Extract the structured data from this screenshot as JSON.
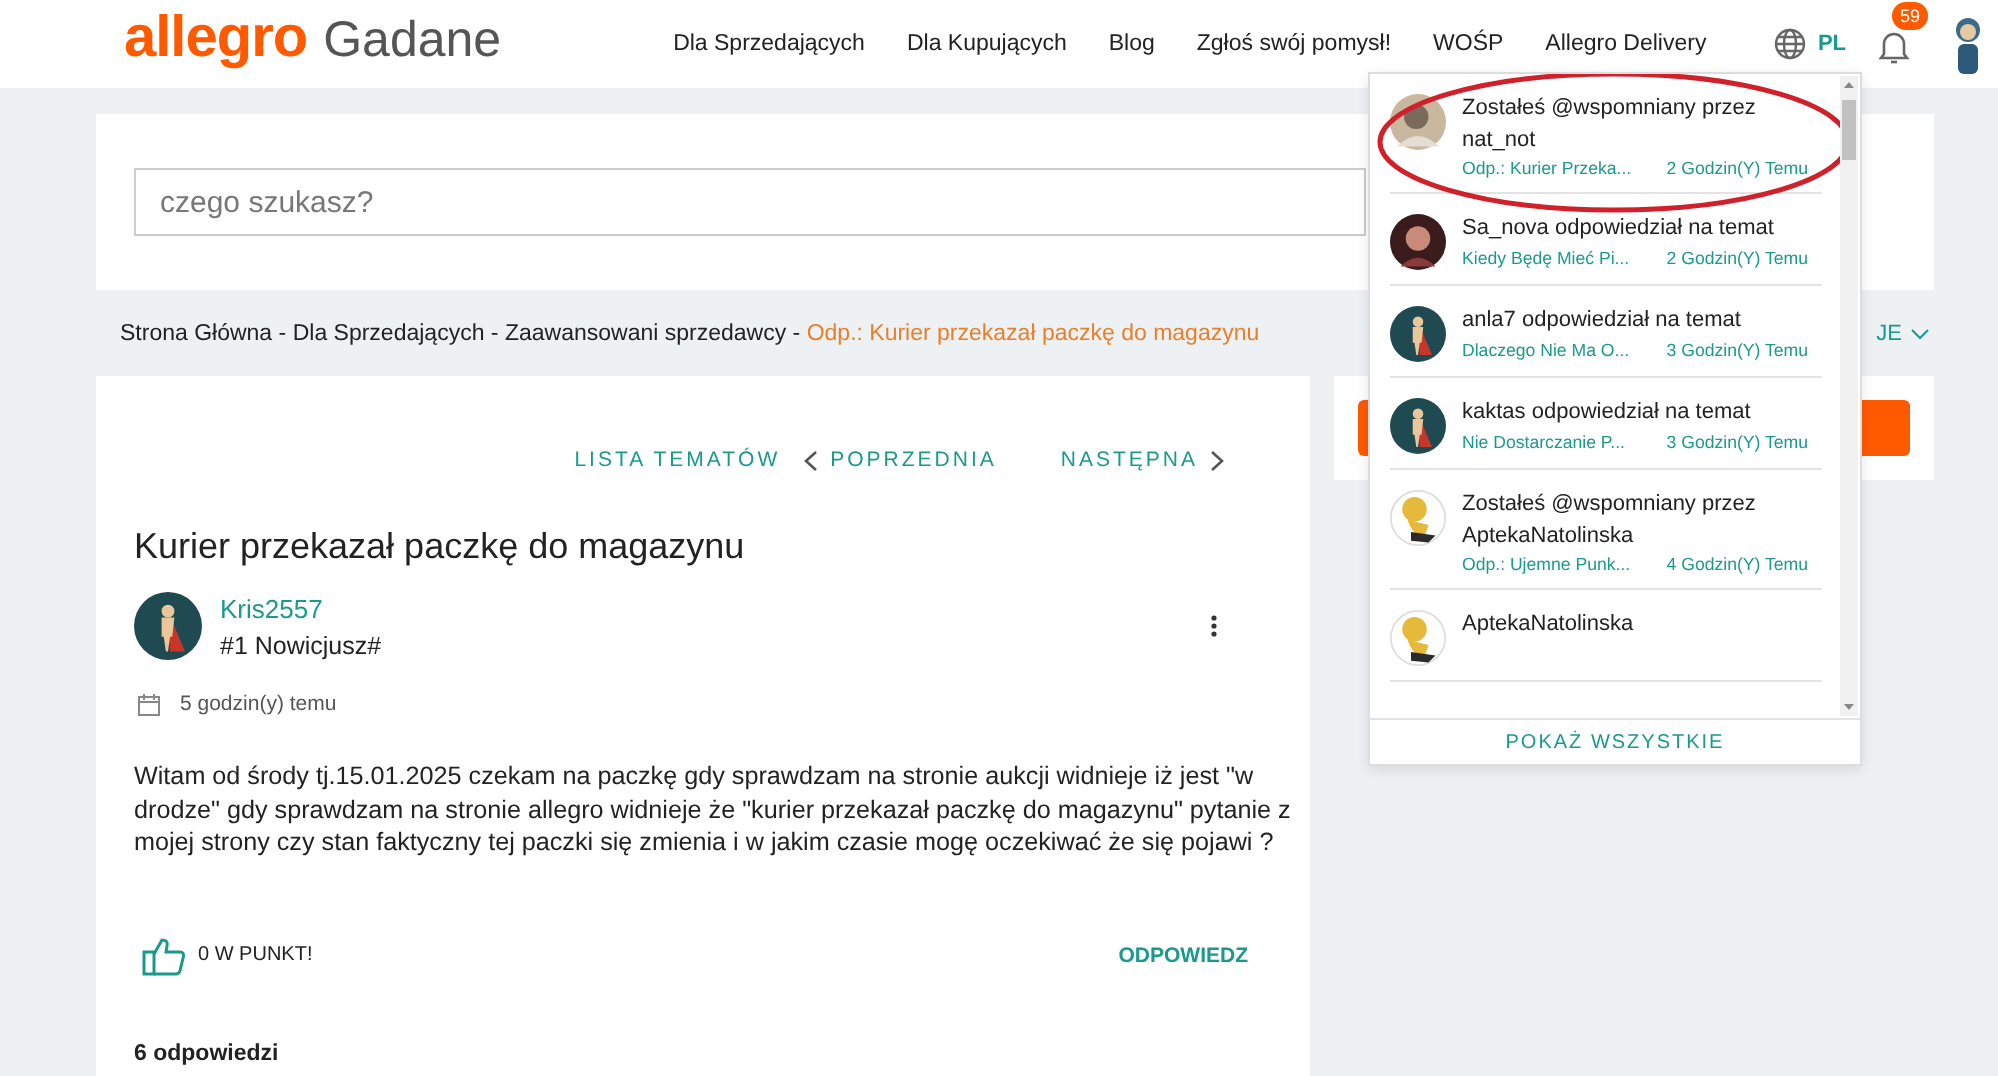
{
  "header": {
    "logo": "allegro",
    "logo_suffix": "Gadane",
    "nav": [
      "Dla Sprzedających",
      "Dla Kupujących",
      "Blog",
      "Zgłoś swój pomysł!",
      "WOŚP",
      "Allegro Delivery"
    ],
    "language": "PL",
    "notification_count": "59"
  },
  "search": {
    "placeholder": "czego szukasz?"
  },
  "breadcrumb": {
    "items": [
      "Strona Główna",
      "Dla Sprzedających",
      "Zaawansowani sprzedawcy"
    ],
    "separator": "-",
    "current": "Odp.: Kurier przekazał paczkę do magazynu"
  },
  "sidebar": {
    "dropdown_label": "JE"
  },
  "topic_nav": {
    "list": "LISTA TEMATÓW",
    "previous": "POPRZEDNIA",
    "next": "NASTĘPNA"
  },
  "post": {
    "title": "Kurier przekazał paczkę do magazynu",
    "author": "Kris2557",
    "rank": "#1 Nowicjusz#",
    "date": "5 godzin(y) temu",
    "body": "Witam od środy tj.15.01.2025 czekam na paczkę gdy sprawdzam na stronie aukcji widnieje iż jest \"w drodze\" gdy sprawdzam na stronie allegro widnieje że \"kurier przekazał paczkę do magazynu\" pytanie z mojej strony czy stan faktyczny tej paczki się zmienia i w jakim czasie mogę oczekiwać że się pojawi ?",
    "likes": "0 W PUNKT!",
    "reply": "ODPOWIEDZ",
    "replies_count": "6 odpowiedzi"
  },
  "notifications": {
    "items": [
      {
        "kind": "photo",
        "text": "Zostałeś @wspomniany przez nat_not",
        "link": "Odp.: Kurier Przeka...",
        "time": "2 Godzin(Y) Temu",
        "highlighted": true
      },
      {
        "kind": "portrait",
        "text": "Sa_nova odpowiedział na temat",
        "link": "Kiedy Będę Mieć Pi...",
        "time": "2 Godzin(Y) Temu",
        "highlighted": false
      },
      {
        "kind": "hero",
        "text": "anla7 odpowiedział na temat",
        "link": "Dlaczego Nie Ma O...",
        "time": "3 Godzin(Y) Temu",
        "highlighted": false
      },
      {
        "kind": "hero",
        "text": "kaktas odpowiedział na temat",
        "link": "Nie Dostarczanie P...",
        "time": "3 Godzin(Y) Temu",
        "highlighted": false
      },
      {
        "kind": "cartoon",
        "text": "Zostałeś @wspomniany przez AptekaNatolinska",
        "link": "Odp.: Ujemne Punk...",
        "time": "4 Godzin(Y) Temu",
        "highlighted": false
      },
      {
        "kind": "cartoon",
        "text": "AptekaNatolinska",
        "highlighted": false
      }
    ],
    "show_all": "POKAŻ WSZYSTKIE"
  }
}
